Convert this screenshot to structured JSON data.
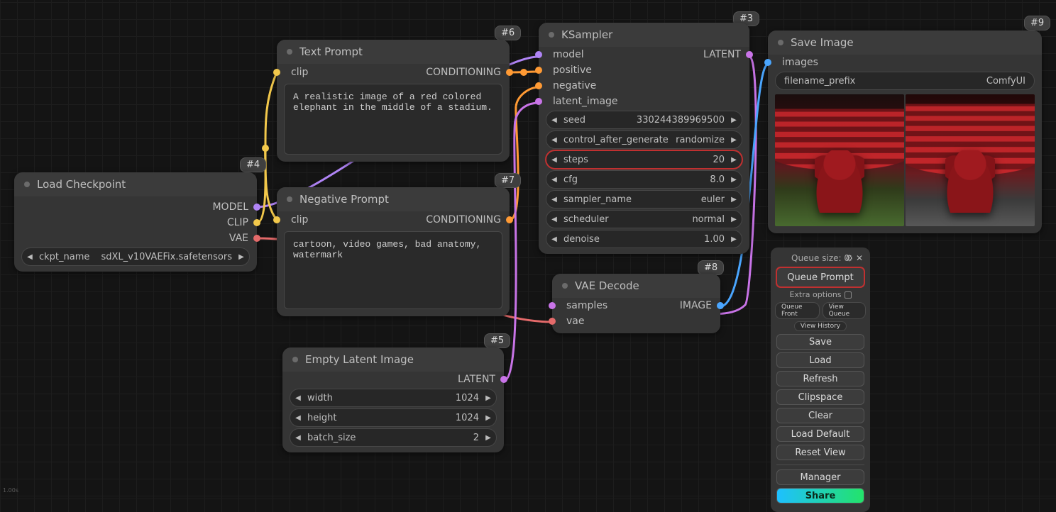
{
  "corner": "1.00s",
  "chips": {
    "n4": "#4",
    "n6": "#6",
    "n3": "#3",
    "n9": "#9",
    "n7": "#7",
    "n5": "#5",
    "n8": "#8"
  },
  "colors": {
    "model": "#b084f6",
    "clip": "#f2c84b",
    "vae": "#e46a6a",
    "conditioning": "#ff9a34",
    "latent": "#c974e8",
    "image": "#4aa6ff"
  },
  "nodes": {
    "load": {
      "title": "Load Checkpoint",
      "outputs": [
        {
          "label": "MODEL",
          "port": "model"
        },
        {
          "label": "CLIP",
          "port": "clip"
        },
        {
          "label": "VAE",
          "port": "vae"
        }
      ],
      "ckpt": {
        "label": "ckpt_name",
        "value": "sdXL_v10VAEFix.safetensors"
      }
    },
    "posPrompt": {
      "title": "Text Prompt",
      "input": {
        "label": "clip",
        "port": "clip"
      },
      "output": {
        "label": "CONDITIONING",
        "port": "conditioning"
      },
      "text": "A realistic image of a red colored elephant in the middle of a stadium."
    },
    "negPrompt": {
      "title": "Negative Prompt",
      "input": {
        "label": "clip",
        "port": "clip"
      },
      "output": {
        "label": "CONDITIONING",
        "port": "conditioning"
      },
      "text": "cartoon, video games, bad anatomy, watermark"
    },
    "empty": {
      "title": "Empty Latent Image",
      "output": {
        "label": "LATENT",
        "port": "latent"
      },
      "width": {
        "label": "width",
        "value": "1024"
      },
      "height": {
        "label": "height",
        "value": "1024"
      },
      "batch": {
        "label": "batch_size",
        "value": "2"
      }
    },
    "ks": {
      "title": "KSampler",
      "inputs": [
        {
          "label": "model",
          "port": "model"
        },
        {
          "label": "positive",
          "port": "conditioning"
        },
        {
          "label": "negative",
          "port": "conditioning"
        },
        {
          "label": "latent_image",
          "port": "latent"
        }
      ],
      "output": {
        "label": "LATENT",
        "port": "latent"
      },
      "fields": [
        {
          "k": "seed",
          "v": "330244389969500",
          "hl": false
        },
        {
          "k": "control_after_generate",
          "v": "randomize",
          "hl": false
        },
        {
          "k": "steps",
          "v": "20",
          "hl": true
        },
        {
          "k": "cfg",
          "v": "8.0",
          "hl": false
        },
        {
          "k": "sampler_name",
          "v": "euler",
          "hl": false
        },
        {
          "k": "scheduler",
          "v": "normal",
          "hl": false
        },
        {
          "k": "denoise",
          "v": "1.00",
          "hl": false
        }
      ]
    },
    "vaedec": {
      "title": "VAE Decode",
      "inputs": [
        {
          "label": "samples",
          "port": "latent"
        },
        {
          "label": "vae",
          "port": "vae"
        }
      ],
      "output": {
        "label": "IMAGE",
        "port": "image"
      }
    },
    "save": {
      "title": "Save Image",
      "input": {
        "label": "images",
        "port": "image"
      },
      "prefix": {
        "label": "filename_prefix",
        "value": "ComfyUI"
      }
    }
  },
  "menu": {
    "queueSize": "Queue size: 0",
    "queuePrompt": "Queue Prompt",
    "extraOptions": "Extra options",
    "queueFront": "Queue Front",
    "viewQueue": "View Queue",
    "viewHistory": "View History",
    "buttons": [
      "Save",
      "Load",
      "Refresh",
      "Clipspace",
      "Clear",
      "Load Default",
      "Reset View"
    ],
    "manager": "Manager",
    "share": "Share"
  }
}
